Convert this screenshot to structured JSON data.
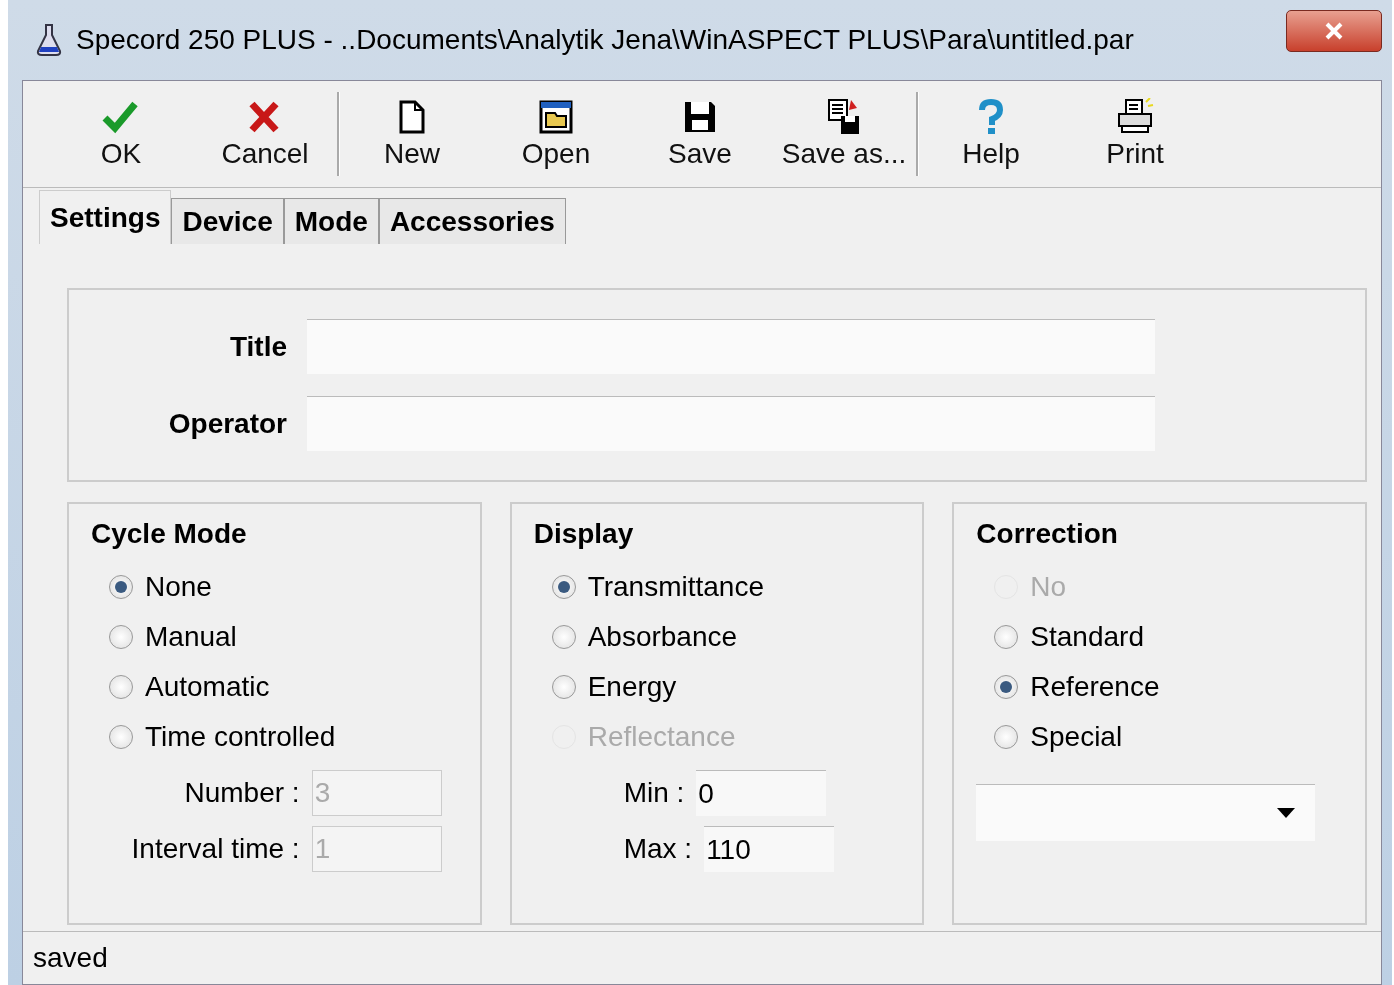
{
  "window": {
    "title": "Specord 250 PLUS - ..Documents\\Analytik Jena\\WinASPECT PLUS\\Para\\untitled.par"
  },
  "toolbar": [
    {
      "kind": "ok",
      "label": "OK"
    },
    {
      "kind": "cancel",
      "label": "Cancel"
    },
    {
      "kind": "separator"
    },
    {
      "kind": "new",
      "label": "New"
    },
    {
      "kind": "open",
      "label": "Open"
    },
    {
      "kind": "save",
      "label": "Save"
    },
    {
      "kind": "saveas",
      "label": "Save as..."
    },
    {
      "kind": "separator"
    },
    {
      "kind": "help",
      "label": "Help"
    },
    {
      "kind": "print",
      "label": "Print"
    }
  ],
  "tabs": [
    {
      "label": "Settings",
      "selected": true
    },
    {
      "label": "Device",
      "selected": false
    },
    {
      "label": "Mode",
      "selected": false
    },
    {
      "label": "Accessories",
      "selected": false
    }
  ],
  "header_fields": [
    {
      "label": "Title"
    },
    {
      "label": "Operator"
    }
  ],
  "groups": [
    {
      "title": "Cycle Mode",
      "options": [
        {
          "label": "None",
          "selected": true,
          "disabled": false
        },
        {
          "label": "Manual",
          "selected": false,
          "disabled": false
        },
        {
          "label": "Automatic",
          "selected": false,
          "disabled": false
        },
        {
          "label": "Time controlled",
          "selected": false,
          "disabled": false
        }
      ],
      "fields": [
        {
          "label": "Number :",
          "value": "3",
          "disabled": true
        },
        {
          "label": "Interval time :",
          "value": "1",
          "disabled": true
        }
      ]
    },
    {
      "title": "Display",
      "options": [
        {
          "label": "Transmittance",
          "selected": true,
          "disabled": false
        },
        {
          "label": "Absorbance",
          "selected": false,
          "disabled": false
        },
        {
          "label": "Energy",
          "selected": false,
          "disabled": false
        },
        {
          "label": "Reflectance",
          "selected": false,
          "disabled": true
        }
      ],
      "fields": [
        {
          "label": "Min :",
          "value": "0",
          "disabled": false
        },
        {
          "label": "Max :",
          "value": "110",
          "disabled": false
        }
      ]
    },
    {
      "title": "Correction",
      "options": [
        {
          "label": "No",
          "selected": false,
          "disabled": true
        },
        {
          "label": "Standard",
          "selected": false,
          "disabled": false
        },
        {
          "label": "Reference",
          "selected": true,
          "disabled": false
        },
        {
          "label": "Special",
          "selected": false,
          "disabled": false
        }
      ],
      "dropdown": true
    }
  ],
  "status_bar": {
    "text": "saved"
  }
}
